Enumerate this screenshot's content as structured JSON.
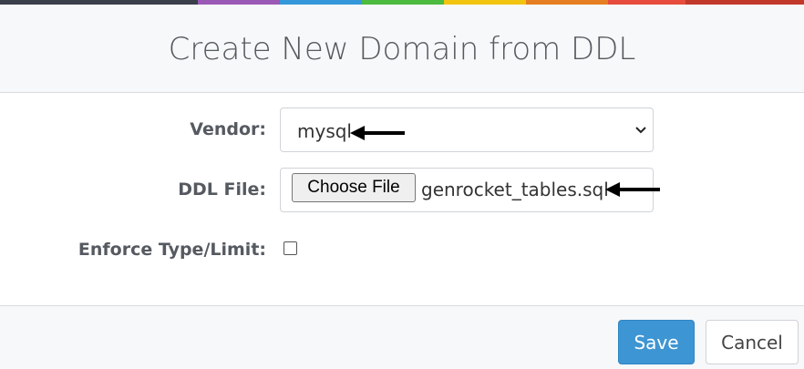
{
  "modal": {
    "title": "Create New Domain from DDL"
  },
  "form": {
    "vendor_label": "Vendor:",
    "vendor_value": "mysql",
    "ddl_file_label": "DDL File:",
    "choose_file_label": "Choose File",
    "ddl_file_name": "genrocket_tables.sql",
    "enforce_label": "Enforce Type/Limit:",
    "enforce_checked": false
  },
  "footer": {
    "save_label": "Save",
    "cancel_label": "Cancel"
  },
  "colors": {
    "stripe": [
      "#3a3f4a",
      "#9b59b6",
      "#3498db",
      "#4cbb3f",
      "#f1c40f",
      "#e67e22",
      "#e74c3c",
      "#c0392b"
    ],
    "save_button": "#3e95d3",
    "annotation_arrow": "#000000"
  }
}
